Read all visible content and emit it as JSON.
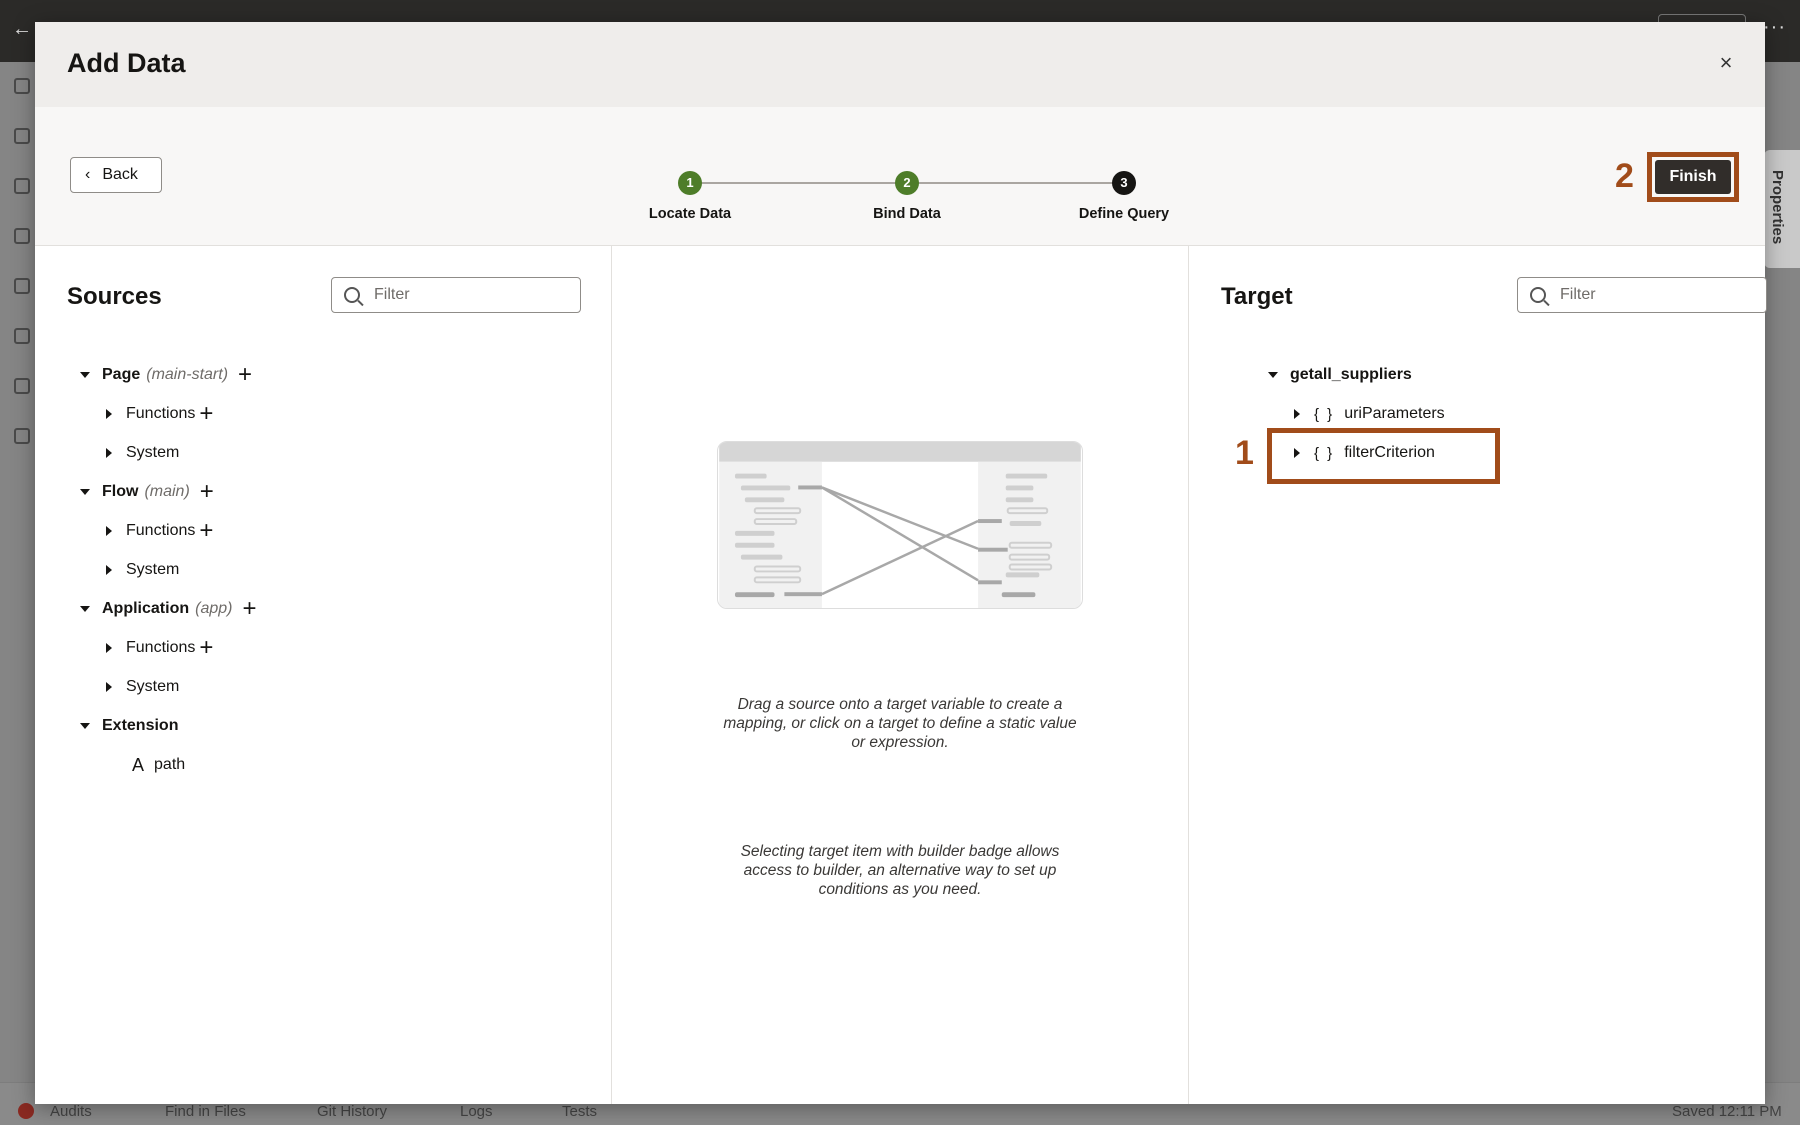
{
  "modal": {
    "title": "Add Data",
    "close_glyph": "×",
    "back_label": "Back",
    "finish_label": "Finish"
  },
  "train": {
    "steps": [
      {
        "num": "1",
        "label": "Locate Data",
        "state": "done"
      },
      {
        "num": "2",
        "label": "Bind Data",
        "state": "done"
      },
      {
        "num": "3",
        "label": "Define Query",
        "state": "current"
      }
    ]
  },
  "sources": {
    "title": "Sources",
    "filter_placeholder": "Filter",
    "tree": {
      "page": {
        "label": "Page",
        "sub": "(main-start)"
      },
      "page_functions": "Functions",
      "page_system": "System",
      "flow": {
        "label": "Flow",
        "sub": "(main)"
      },
      "flow_functions": "Functions",
      "flow_system": "System",
      "application": {
        "label": "Application",
        "sub": "(app)"
      },
      "app_functions": "Functions",
      "app_system": "System",
      "extension": "Extension",
      "path": "path"
    }
  },
  "middle": {
    "help1": "Drag a source onto a target variable to create a mapping, or click on a target to define a static value or expression.",
    "help2": "Selecting target item with builder badge allows access to builder, an alternative way to set up conditions as you need."
  },
  "target": {
    "title": "Target",
    "filter_placeholder": "Filter",
    "root": "getall_suppliers",
    "items": [
      "uriParameters",
      "filterCriterion"
    ],
    "braces_glyph": "{ }"
  },
  "annotations": {
    "one": "1",
    "two": "2",
    "color": "#a14c1a"
  },
  "background": {
    "bottom_items": [
      "Audits",
      "Find in Files",
      "Git History",
      "Logs",
      "Tests"
    ],
    "saved": "Saved 12:11 PM",
    "properties_tab": "Properties"
  },
  "icons": [
    "close-icon",
    "chevron-left-icon",
    "search-icon",
    "caret-down-icon",
    "caret-right-icon",
    "plus-icon",
    "string-type-icon",
    "object-braces-icon"
  ]
}
